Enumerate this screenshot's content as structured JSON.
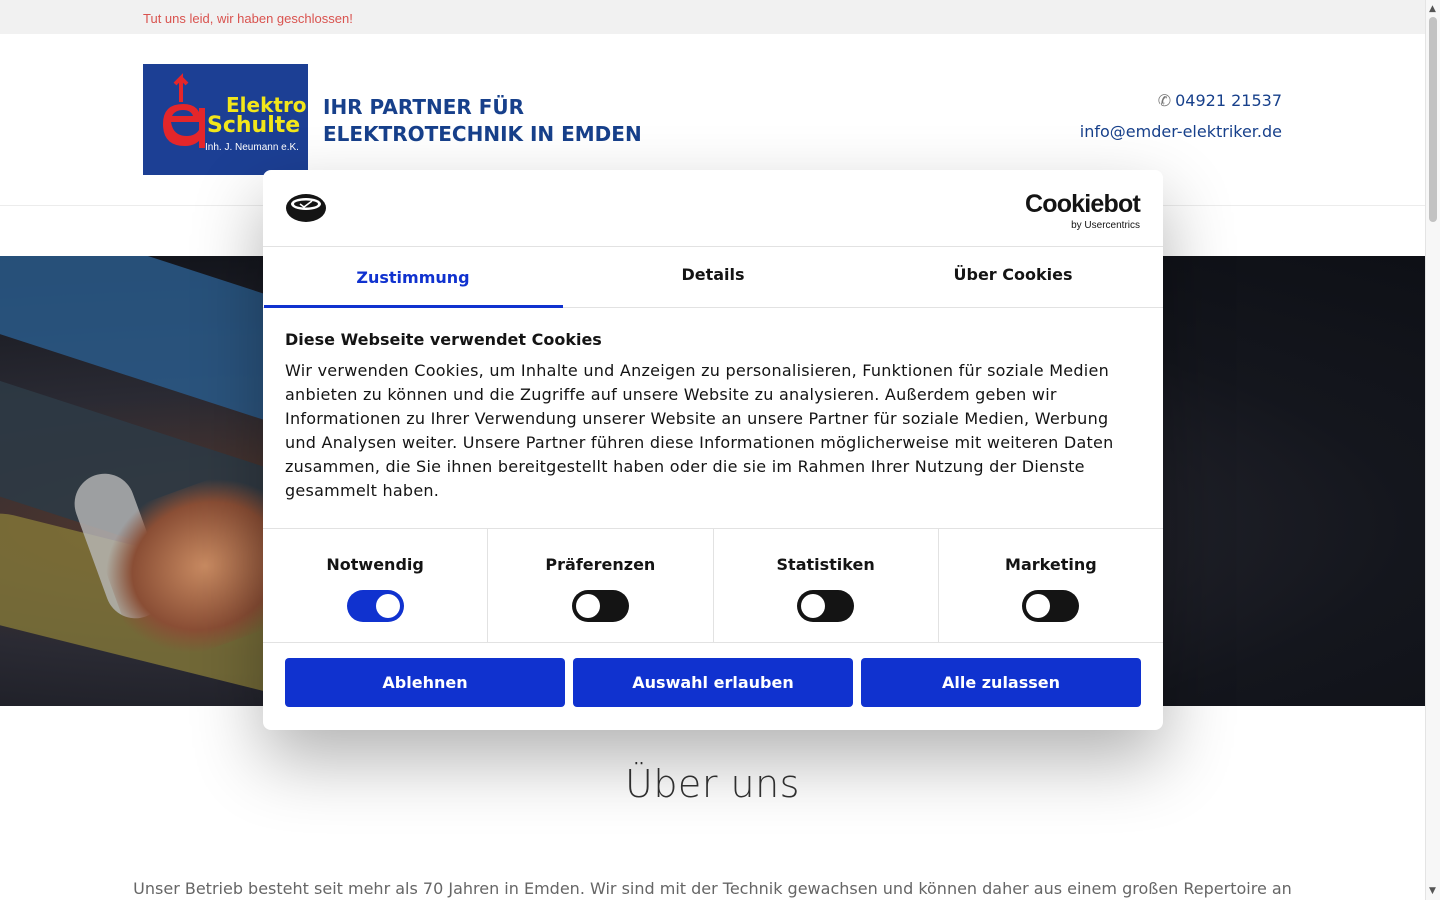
{
  "notice": {
    "text": "Tut uns leid, wir haben geschlossen!"
  },
  "header": {
    "logo": {
      "line1": "Elektro",
      "line2": "Schulte",
      "line3": "Inh. J. Neumann e.K."
    },
    "tagline_line1": "IHR PARTNER FÜR",
    "tagline_line2": "ELEKTROTECHNIK IN EMDEN",
    "phone_icon": "✆",
    "phone": "04921 21537",
    "email": "info@emder-elektriker.de"
  },
  "about": {
    "title": "Über uns",
    "text": "Unser Betrieb besteht seit mehr als 70 Jahren in Emden. Wir sind mit der Technik gewachsen und können daher aus einem großen Repertoire an"
  },
  "cookie_dialog": {
    "brand_name": "Cookiebot",
    "brand_sub": "by Usercentrics",
    "tabs": [
      {
        "label": "Zustimmung",
        "active": true
      },
      {
        "label": "Details",
        "active": false
      },
      {
        "label": "Über Cookies",
        "active": false
      }
    ],
    "title": "Diese Webseite verwendet Cookies",
    "body": "Wir verwenden Cookies, um Inhalte und Anzeigen zu personalisieren, Funktionen für soziale Medien anbieten zu können und die Zugriffe auf unsere Website zu analysieren. Außerdem geben wir Informationen zu Ihrer Verwendung unserer Website an unsere Partner für soziale Medien, Werbung und Analysen weiter. Unsere Partner führen diese Informationen möglicherweise mit weiteren Daten zusammen, die Sie ihnen bereitgestellt haben oder die sie im Rahmen Ihrer Nutzung der Dienste gesammelt haben.",
    "categories": [
      {
        "label": "Notwendig",
        "enabled": true
      },
      {
        "label": "Präferenzen",
        "enabled": false
      },
      {
        "label": "Statistiken",
        "enabled": false
      },
      {
        "label": "Marketing",
        "enabled": false
      }
    ],
    "buttons": {
      "decline": "Ablehnen",
      "allow_selection": "Auswahl erlauben",
      "allow_all": "Alle zulassen"
    }
  },
  "colors": {
    "accent": "#1032cf",
    "brand_blue": "#17408b",
    "notice_red": "#d9534f",
    "logo_bg": "#1c3f94",
    "logo_yellow": "#f2e61a"
  }
}
